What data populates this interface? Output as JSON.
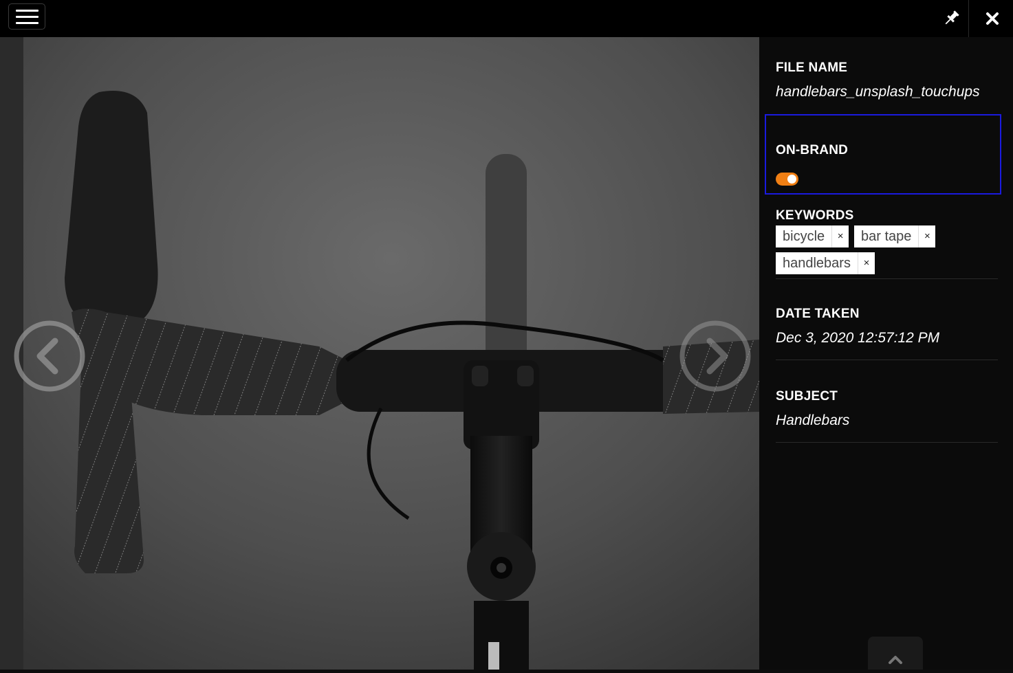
{
  "toolbar": {
    "menu_icon": "hamburger-menu-icon",
    "pin_icon": "pin-icon",
    "close_icon": "close-icon"
  },
  "viewer": {
    "prev_icon": "chevron-left-icon",
    "next_icon": "chevron-right-icon"
  },
  "panel": {
    "file_name_label": "FILE NAME",
    "file_name_value": "handlebars_unsplash_touchups",
    "on_brand_label": "ON-BRAND",
    "on_brand_on": true,
    "keywords_label": "KEYWORDS",
    "keywords": [
      "bicycle",
      "bar tape",
      "handlebars"
    ],
    "keyword_remove": "×",
    "date_label": "DATE TAKEN",
    "date_value": "Dec 3, 2020 12:57:12 PM",
    "subject_label": "SUBJECT",
    "subject_value": "Handlebars",
    "scroll_icon": "chevron-up-icon"
  },
  "colors": {
    "toggle_on": "#f07f14",
    "focus_outline": "#1a1ae0"
  }
}
